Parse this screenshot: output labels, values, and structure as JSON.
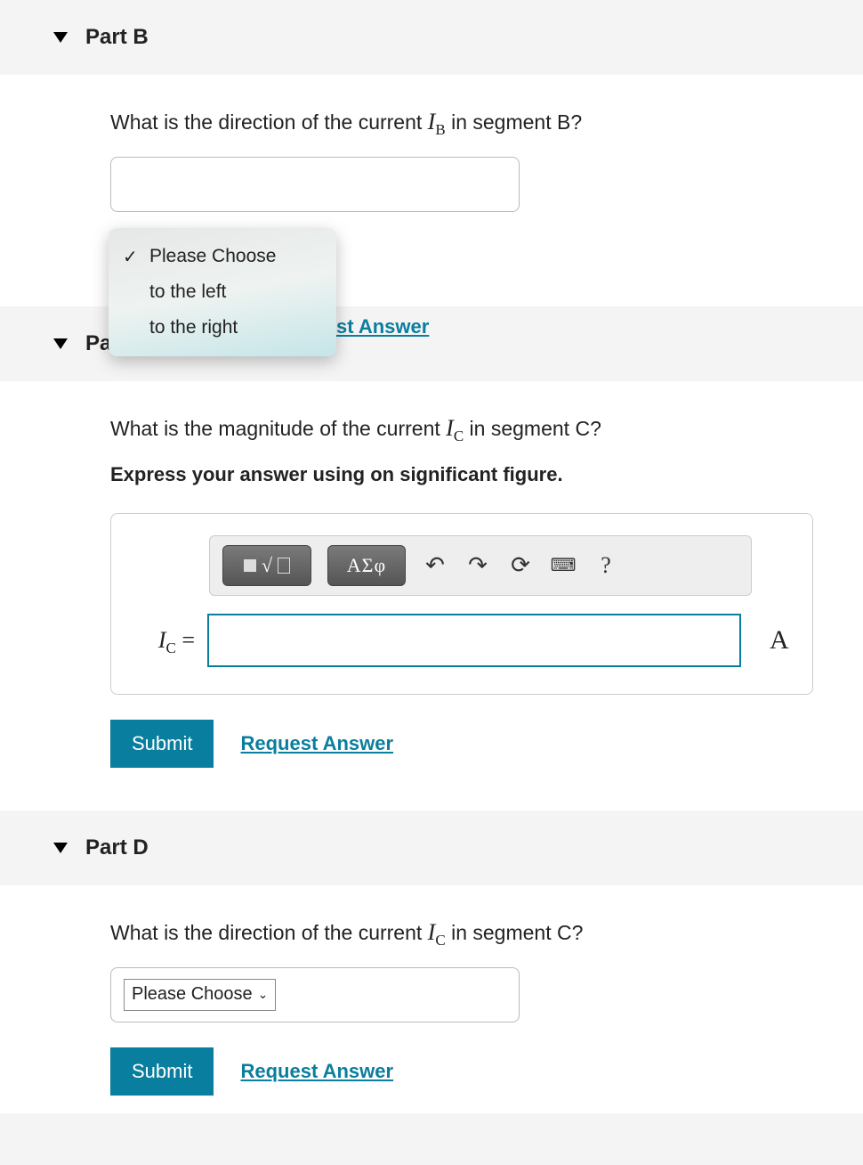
{
  "partB": {
    "title": "Part B",
    "question_pre": "What is the direction of the current ",
    "question_var": "I",
    "question_sub": "B",
    "question_post": " in segment B?",
    "dropdown": {
      "placeholder": "Please Choose",
      "options": [
        "Please Choose",
        "to the left",
        "to the right"
      ],
      "selected": "Please Choose"
    },
    "partial_link": "st Answer"
  },
  "partC": {
    "title": "Part C",
    "question_pre": "What is the magnitude of the current ",
    "question_var": "I",
    "question_sub": "C",
    "question_post": " in segment C?",
    "instruction": "Express your answer using on significant figure.",
    "toolbar": {
      "templates_label": "√",
      "greek_label": "ΑΣφ",
      "undo": "↶",
      "redo": "↷",
      "reset": "⟳",
      "keyboard": "⌨",
      "help": "?"
    },
    "input_label_var": "I",
    "input_label_sub": "C",
    "input_label_eq": " =",
    "unit": "A",
    "submit": "Submit",
    "request": "Request Answer"
  },
  "partD": {
    "title": "Part D",
    "question_pre": "What is the direction of the current ",
    "question_var": "I",
    "question_sub": "C",
    "question_post": " in segment C?",
    "select_text": "Please Choose",
    "submit": "Submit",
    "request": "Request Answer"
  }
}
